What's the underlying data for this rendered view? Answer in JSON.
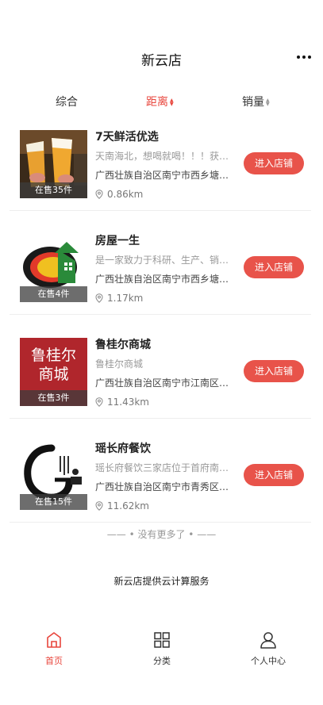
{
  "header": {
    "title": "新云店",
    "more_icon": "more-dots-icon"
  },
  "sort": {
    "items": [
      {
        "label": "综合",
        "active": false,
        "has_arrows": false
      },
      {
        "label": "距离",
        "active": true,
        "has_arrows": true
      },
      {
        "label": "销量",
        "active": false,
        "has_arrows": true
      }
    ]
  },
  "shops": [
    {
      "name": "7天鲜活优选",
      "desc": "天南海北，想喝就喝！！！获…",
      "address": "广西壮族自治区南宁市西乡塘…",
      "distance": "0.86km",
      "on_sale": "在售35件",
      "button": "进入店铺"
    },
    {
      "name": "房屋一生",
      "desc": "是一家致力于科研、生产、销…",
      "address": "广西壮族自治区南宁市西乡塘…",
      "distance": "1.17km",
      "on_sale": "在售4件",
      "button": "进入店铺"
    },
    {
      "name": "鲁桂尔商城",
      "desc": "鲁桂尔商城",
      "address": "广西壮族自治区南宁市江南区…",
      "distance": "11.43km",
      "on_sale": "在售3件",
      "button": "进入店铺",
      "logo_text": "鲁桂尔商城"
    },
    {
      "name": "瑶长府餐饮",
      "desc": "瑶长府餐饮三家店位于首府南…",
      "address": "广西壮族自治区南宁市青秀区…",
      "distance": "11.62km",
      "on_sale": "在售15件",
      "button": "进入店铺"
    }
  ],
  "footer": {
    "no_more": "—— • 没有更多了 • ——",
    "provider": "新云店提供云计算服务"
  },
  "tabbar": {
    "items": [
      {
        "label": "首页",
        "icon": "home-icon",
        "active": true
      },
      {
        "label": "分类",
        "icon": "grid-icon",
        "active": false
      },
      {
        "label": "个人中心",
        "icon": "user-icon",
        "active": false
      }
    ]
  },
  "colors": {
    "accent": "#e8453c",
    "button": "#e8534a"
  }
}
